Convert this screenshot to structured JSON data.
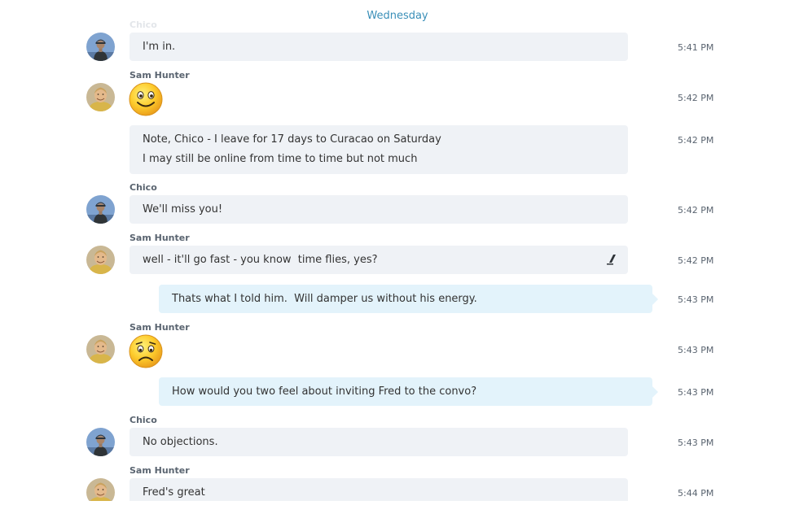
{
  "conversation": {
    "day_label": "Wednesday",
    "messages": [
      {
        "sender": "Chico",
        "text": "I'm in.",
        "time": "5:41 PM"
      },
      {
        "sender": "Sam Hunter",
        "emoticon": "smile-emoticon",
        "time": "5:42 PM"
      },
      {
        "text_lines": [
          "Note, Chico - I leave for 17 days to Curacao on Saturday",
          "I may still be online from time to time but not much"
        ],
        "time": "5:42 PM"
      },
      {
        "sender": "Chico",
        "text": "We'll miss you!",
        "time": "5:42 PM"
      },
      {
        "sender": "Sam Hunter",
        "text": "well - it'll go fast - you know  time flies, yes?",
        "time": "5:42 PM",
        "edited_icon": "edited-pencil-icon"
      },
      {
        "outgoing": true,
        "text": "Thats what I told him.  Will damper us without his energy.",
        "time": "5:43 PM"
      },
      {
        "sender": "Sam Hunter",
        "emoticon": "sad-emoticon",
        "time": "5:43 PM"
      },
      {
        "outgoing": true,
        "text": "How would you two feel about inviting Fred to the convo?",
        "time": "5:43 PM"
      },
      {
        "sender": "Chico",
        "text": "No objections.",
        "time": "5:43 PM"
      },
      {
        "sender": "Sam Hunter",
        "text": "Fred's great",
        "time": "5:44 PM"
      }
    ]
  },
  "colors": {
    "incoming_bubble": "#eff2f6",
    "outgoing_bubble": "#e3f3fb",
    "day_label": "#3a8fb8",
    "timestamp": "#5a6470",
    "emoticon_face": "#fdcb2c"
  },
  "icons": {
    "avatar_chico": "person-photo-avatar",
    "avatar_sam": "person-photo-avatar"
  }
}
